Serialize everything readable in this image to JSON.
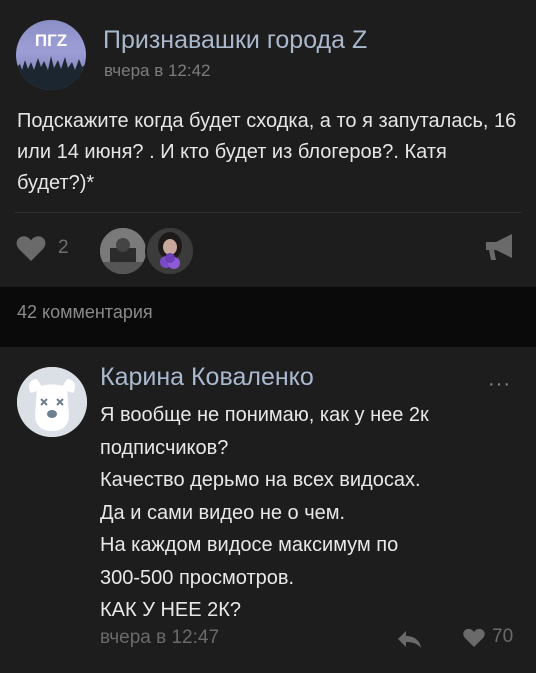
{
  "post": {
    "group_name": "Признавашки города Z",
    "time": "вчера в 12:42",
    "text": "Подскажите когда будет сходка, а то я запуталась, 16 или 14 июня? . И кто будет из блогеров?. Катя будет?)*",
    "likes": "2",
    "avatar_text": "ПГZ"
  },
  "comments_header": "42 комментария",
  "comment": {
    "author": "Карина Коваленко",
    "lines": [
      "Я вообще не понимаю, как у нее 2к",
      "подписчиков?",
      "Качество дерьмо на всех видосах.",
      "Да и сами видео не о чем.",
      "На каждом видосе максимум по",
      "300-500 просмотров.",
      "КАК У НЕЕ 2К?"
    ],
    "time": "вчера в 12:47",
    "likes": "70",
    "more": "···"
  },
  "colors": {
    "background": "#0a0a0a",
    "card": "#1d1d1d",
    "link_name": "#aab8cc",
    "muted": "#7d7d7d"
  },
  "icons": [
    "heart-icon",
    "megaphone-share-icon",
    "reply-arrow-icon",
    "more-dots-icon",
    "deleted-user-dog-icon"
  ]
}
